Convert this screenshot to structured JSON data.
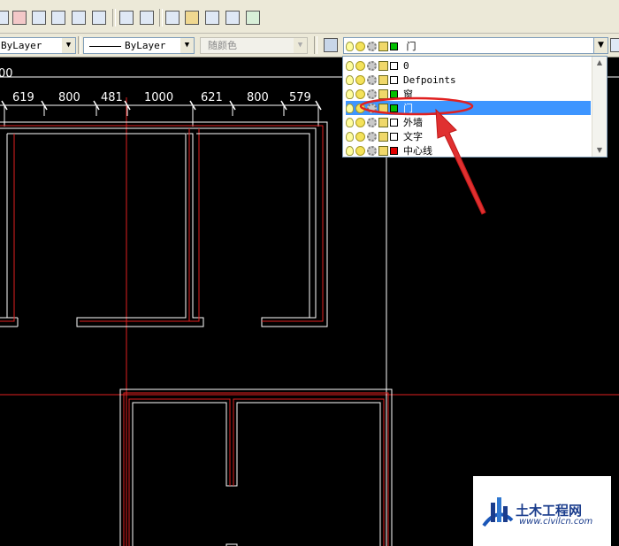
{
  "property_bar": {
    "linetype_value": "ByLayer",
    "lineweight_value": "ByLayer",
    "plotstyle_value": "随颜色"
  },
  "layer_control": {
    "current_layer": "门",
    "current_color": "#00c000",
    "layers": [
      {
        "name": "0",
        "color": "#ffffff",
        "selected": false
      },
      {
        "name": "Defpoints",
        "color": "#ffffff",
        "selected": false
      },
      {
        "name": "窗",
        "color": "#00c000",
        "selected": false
      },
      {
        "name": "门",
        "color": "#00c000",
        "selected": true
      },
      {
        "name": "外墙",
        "color": "#ffffff",
        "selected": false
      },
      {
        "name": "文字",
        "color": "#ffffff",
        "selected": false
      },
      {
        "name": "中心线",
        "color": "#e00000",
        "selected": false
      }
    ]
  },
  "drawing": {
    "dimension_top_left": "00",
    "dimensions": [
      "619",
      "800",
      "481",
      "1000",
      "621",
      "800",
      "579"
    ]
  },
  "annotation": {
    "highlight_color": "#e02020",
    "arrow_color": "#e03030"
  },
  "watermark": {
    "name": "土木工程网",
    "url": "www.civilcn.com"
  }
}
